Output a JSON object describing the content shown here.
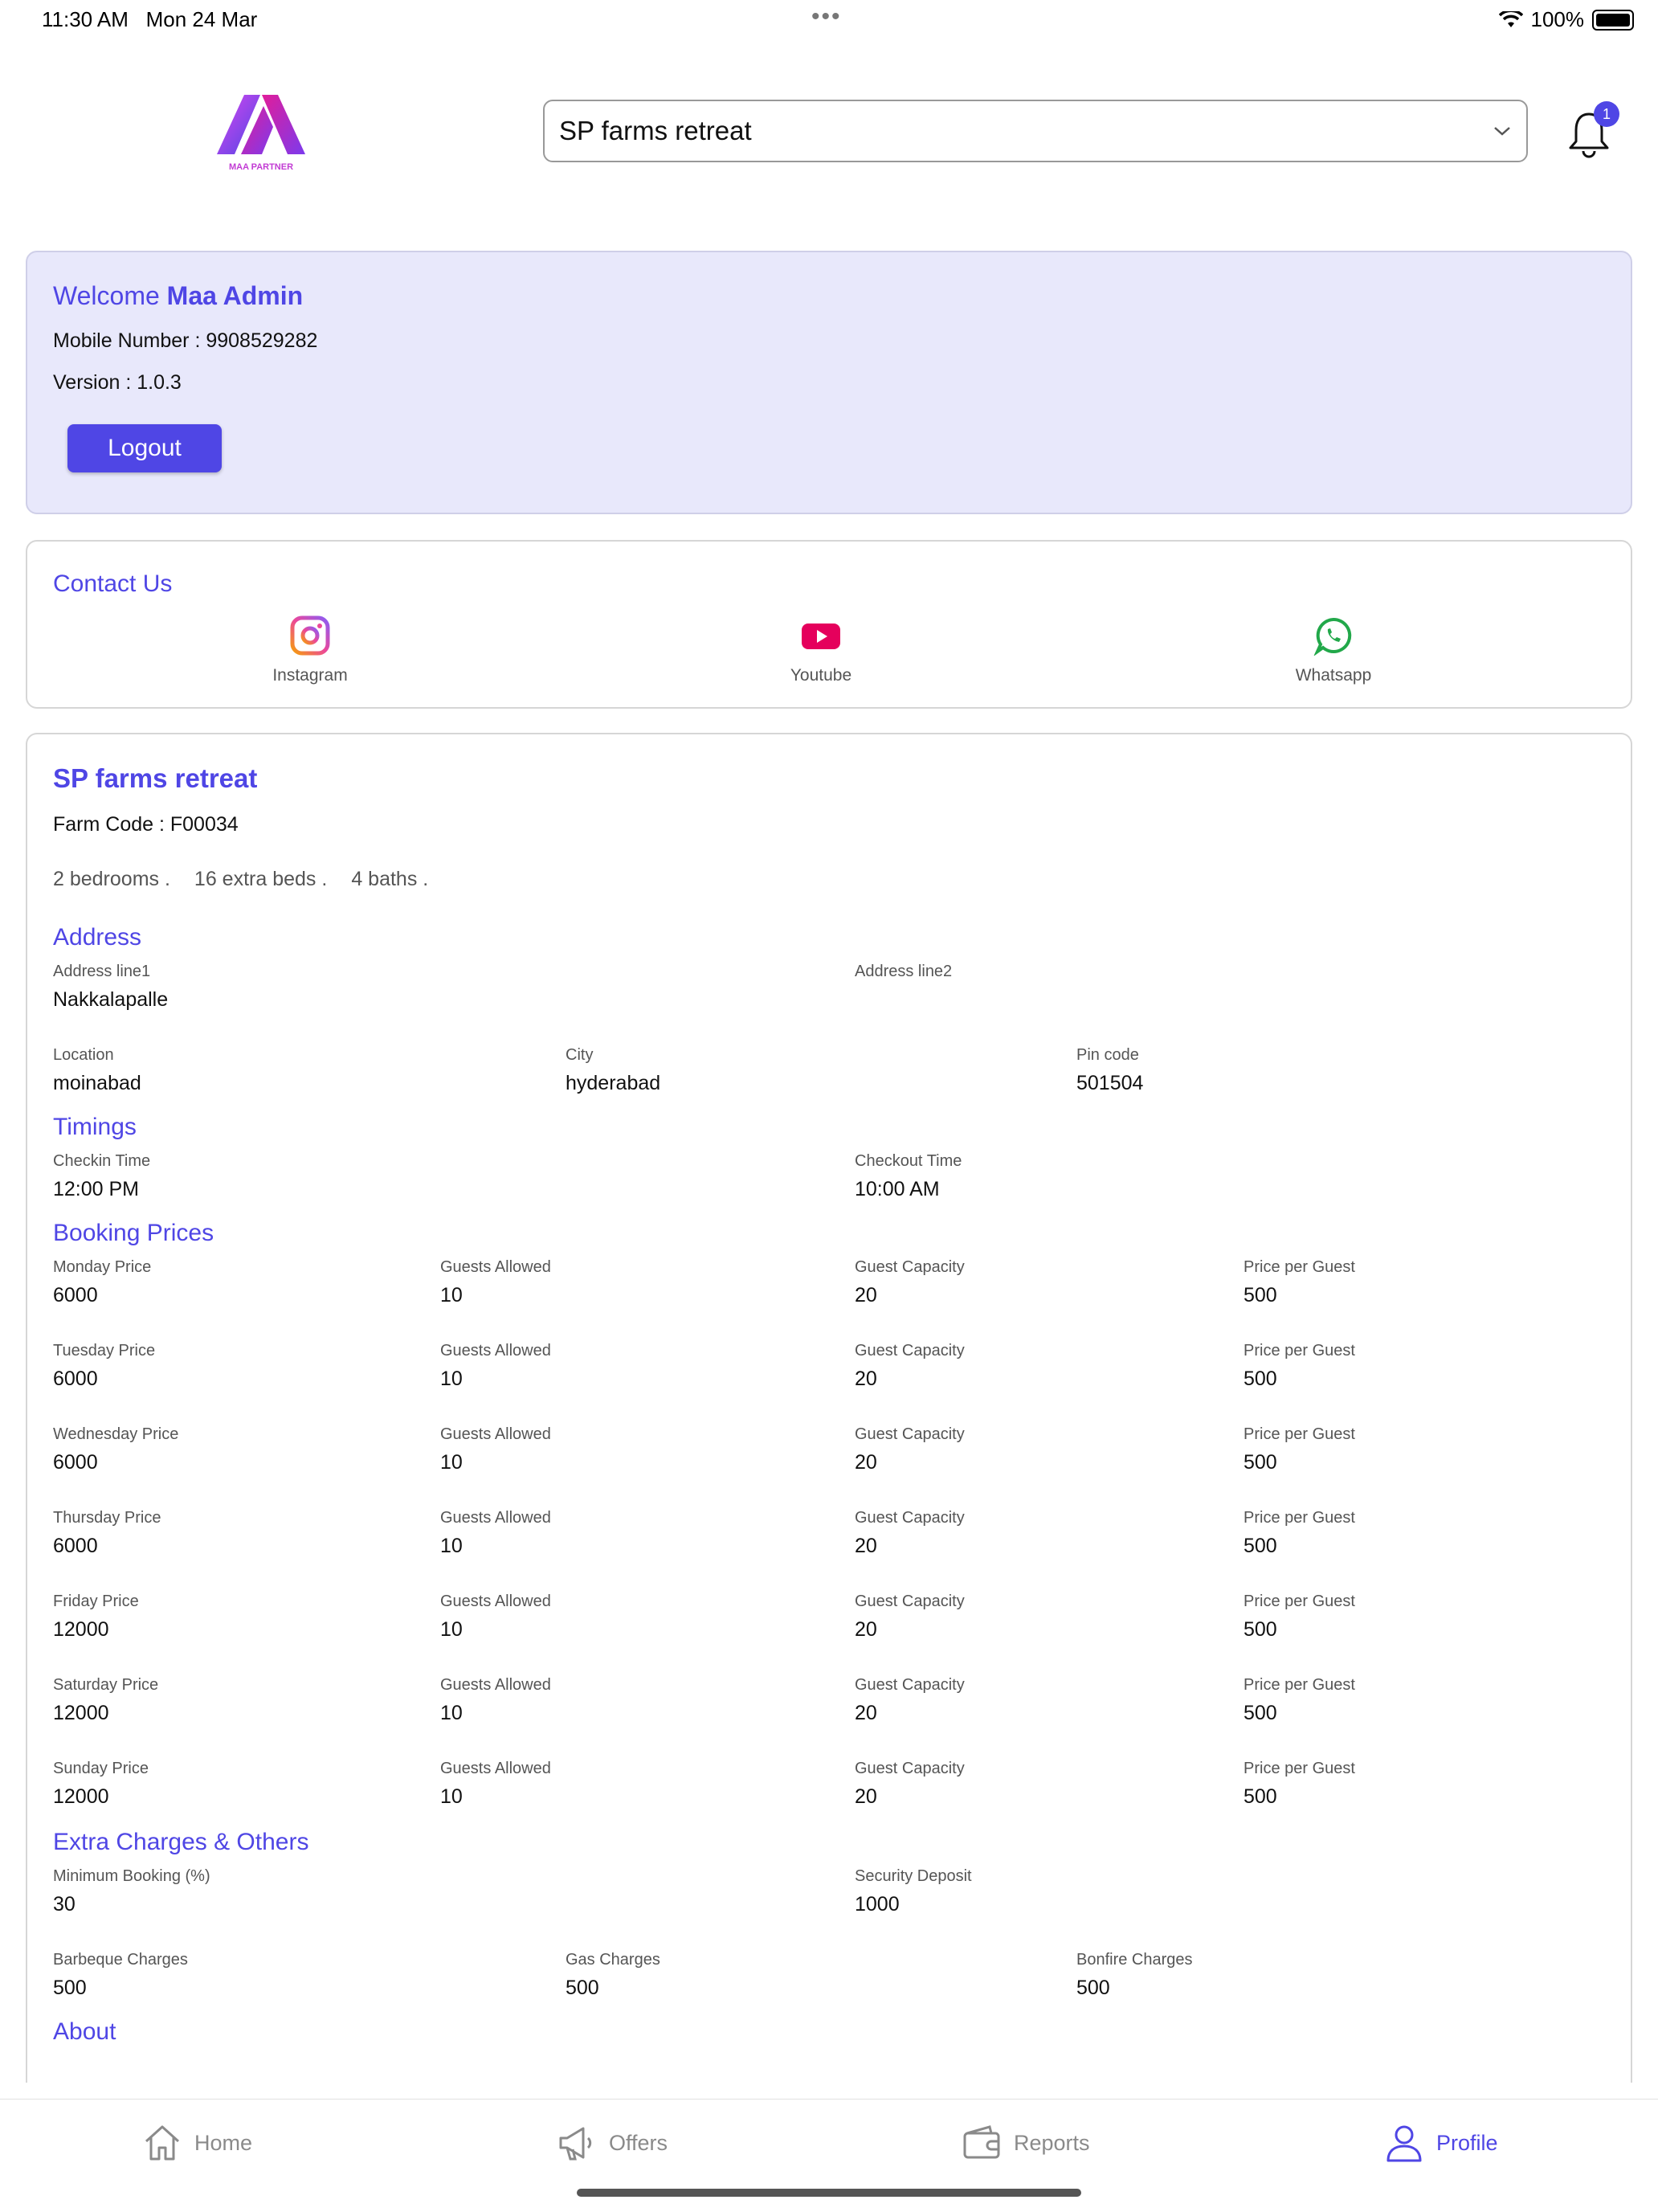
{
  "status": {
    "time": "11:30 AM   Mon 24 Mar",
    "battery": "100%"
  },
  "header": {
    "logo_text": "MAA PARTNER",
    "farm_select": "SP farms retreat",
    "notification_count": "1"
  },
  "welcome": {
    "greeting_prefix": "Welcome ",
    "name": "Maa Admin",
    "mobile": "Mobile Number : 9908529282",
    "version": "Version : 1.0.3",
    "logout_label": "Logout"
  },
  "contact": {
    "title": "Contact Us",
    "instagram": "Instagram",
    "youtube": "Youtube",
    "whatsapp": "Whatsapp"
  },
  "farm": {
    "name": "SP farms retreat",
    "code": "Farm Code : F00034",
    "bedrooms": "2 bedrooms .",
    "extra_beds": "16 extra beds .",
    "baths": "4 baths ."
  },
  "address": {
    "title": "Address",
    "line1_label": "Address line1",
    "line1": "Nakkalapalle",
    "line2_label": "Address line2",
    "line2": "",
    "location_label": "Location",
    "location": "moinabad",
    "city_label": "City",
    "city": "hyderabad",
    "pin_label": "Pin code",
    "pin": "501504"
  },
  "timings": {
    "title": "Timings",
    "checkin_label": "Checkin Time",
    "checkin": "12:00 PM",
    "checkout_label": "Checkout Time",
    "checkout": "10:00 AM"
  },
  "booking": {
    "title": "Booking Prices",
    "rows": [
      {
        "day_label": "Monday Price",
        "price": "6000",
        "ga_label": "Guests Allowed",
        "ga": "10",
        "gc_label": "Guest Capacity",
        "gc": "20",
        "ppg_label": "Price per Guest",
        "ppg": "500"
      },
      {
        "day_label": "Tuesday Price",
        "price": "6000",
        "ga_label": "Guests Allowed",
        "ga": "10",
        "gc_label": "Guest Capacity",
        "gc": "20",
        "ppg_label": "Price per Guest",
        "ppg": "500"
      },
      {
        "day_label": "Wednesday Price",
        "price": "6000",
        "ga_label": "Guests Allowed",
        "ga": "10",
        "gc_label": "Guest Capacity",
        "gc": "20",
        "ppg_label": "Price per Guest",
        "ppg": "500"
      },
      {
        "day_label": "Thursday Price",
        "price": "6000",
        "ga_label": "Guests Allowed",
        "ga": "10",
        "gc_label": "Guest Capacity",
        "gc": "20",
        "ppg_label": "Price per Guest",
        "ppg": "500"
      },
      {
        "day_label": "Friday Price",
        "price": "12000",
        "ga_label": "Guests Allowed",
        "ga": "10",
        "gc_label": "Guest Capacity",
        "gc": "20",
        "ppg_label": "Price per Guest",
        "ppg": "500"
      },
      {
        "day_label": "Saturday Price",
        "price": "12000",
        "ga_label": "Guests Allowed",
        "ga": "10",
        "gc_label": "Guest Capacity",
        "gc": "20",
        "ppg_label": "Price per Guest",
        "ppg": "500"
      },
      {
        "day_label": "Sunday Price",
        "price": "12000",
        "ga_label": "Guests Allowed",
        "ga": "10",
        "gc_label": "Guest Capacity",
        "gc": "20",
        "ppg_label": "Price per Guest",
        "ppg": "500"
      }
    ]
  },
  "extra": {
    "title": "Extra Charges & Others",
    "min_booking_label": "Minimum Booking (%)",
    "min_booking": "30",
    "deposit_label": "Security Deposit",
    "deposit": "1000",
    "bbq_label": "Barbeque Charges",
    "bbq": "500",
    "gas_label": "Gas Charges",
    "gas": "500",
    "bonfire_label": "Bonfire Charges",
    "bonfire": "500"
  },
  "about": {
    "title": "About"
  },
  "tabs": {
    "home": "Home",
    "offers": "Offers",
    "reports": "Reports",
    "profile": "Profile"
  },
  "colors": {
    "accent": "#4f46e5",
    "welcome_bg": "#e8e8fb"
  }
}
